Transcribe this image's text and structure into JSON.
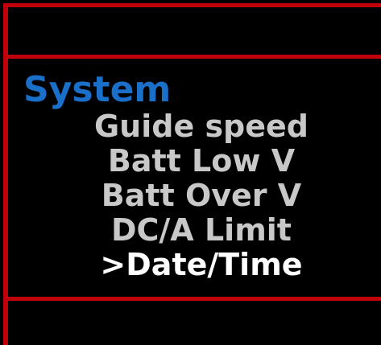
{
  "menu": {
    "title": "System",
    "items": [
      {
        "label": "Guide speed",
        "selected": false
      },
      {
        "label": "Batt Low V",
        "selected": false
      },
      {
        "label": "Batt Over V",
        "selected": false
      },
      {
        "label": "DC/A Limit",
        "selected": false
      },
      {
        "label": ">Date/Time",
        "selected": true
      }
    ]
  },
  "colors": {
    "frame": "#c0000a",
    "title": "#1a6fc8",
    "item": "#c8c8c8",
    "selected_item": "#ffffff",
    "background": "#000000"
  }
}
